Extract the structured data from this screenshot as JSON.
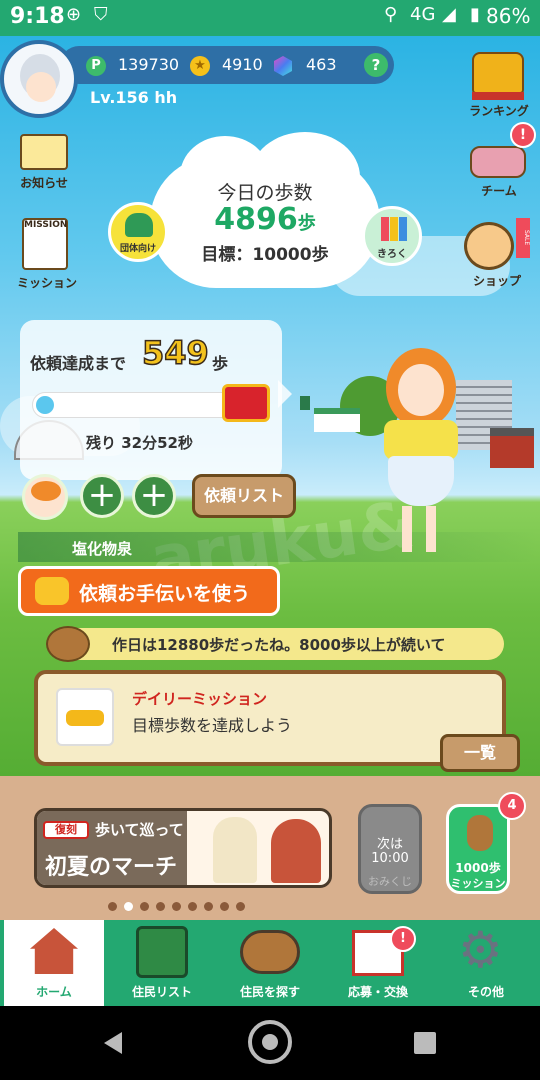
{
  "status_bar": {
    "time": "9:18",
    "network": "4G",
    "battery": "86%"
  },
  "header": {
    "points": "139730",
    "coins": "4910",
    "gems": "463",
    "help": "?",
    "level": "Lv.156 hh"
  },
  "left_menu": {
    "news": "お知らせ",
    "mission": "ミッション",
    "mission_badge": "MISSION"
  },
  "right_menu": {
    "ranking": "ランキング",
    "team": "チーム",
    "shop": "ショップ",
    "sale": "SALE",
    "team_badge": "!"
  },
  "steps_cloud": {
    "title": "今日の歩数",
    "steps": "4896",
    "steps_unit": "歩",
    "goal": "目標：10000歩",
    "group_label": "団体向け",
    "record_label": "きろく"
  },
  "request_panel": {
    "prefix": "依頼達成まで",
    "count": "549",
    "unit": "歩",
    "remaining": "残り 32分52秒",
    "progress": 0.08,
    "list_button": "依頼リスト"
  },
  "location": "塩化物泉",
  "help_button": "依頼お手伝いを使う",
  "ticker": "作日は12880歩だったね。8000歩以上が続いて",
  "daily_mission": {
    "title": "デイリーミッション",
    "desc": "目標歩数を達成しよう",
    "list_button": "一覧"
  },
  "banner": {
    "tag": "復刻",
    "line1": "歩いて巡って",
    "line2": "初夏のマーチ"
  },
  "omikuji": {
    "next": "次は",
    "time": "10:00",
    "label": "おみくじ"
  },
  "mission_1000": {
    "badge": "4",
    "line1": "1000歩",
    "line2": "ミッション"
  },
  "pager": {
    "count": 9,
    "active": 1
  },
  "bottom_nav": [
    {
      "label": "ホーム"
    },
    {
      "label": "住民リスト"
    },
    {
      "label": "住民を探す"
    },
    {
      "label": "応募・交換",
      "badge": "!"
    },
    {
      "label": "その他"
    }
  ],
  "watermark": "aruku&",
  "colors": {
    "green": "#23a871",
    "orange": "#f26a1b",
    "brown": "#8a5a2b"
  }
}
